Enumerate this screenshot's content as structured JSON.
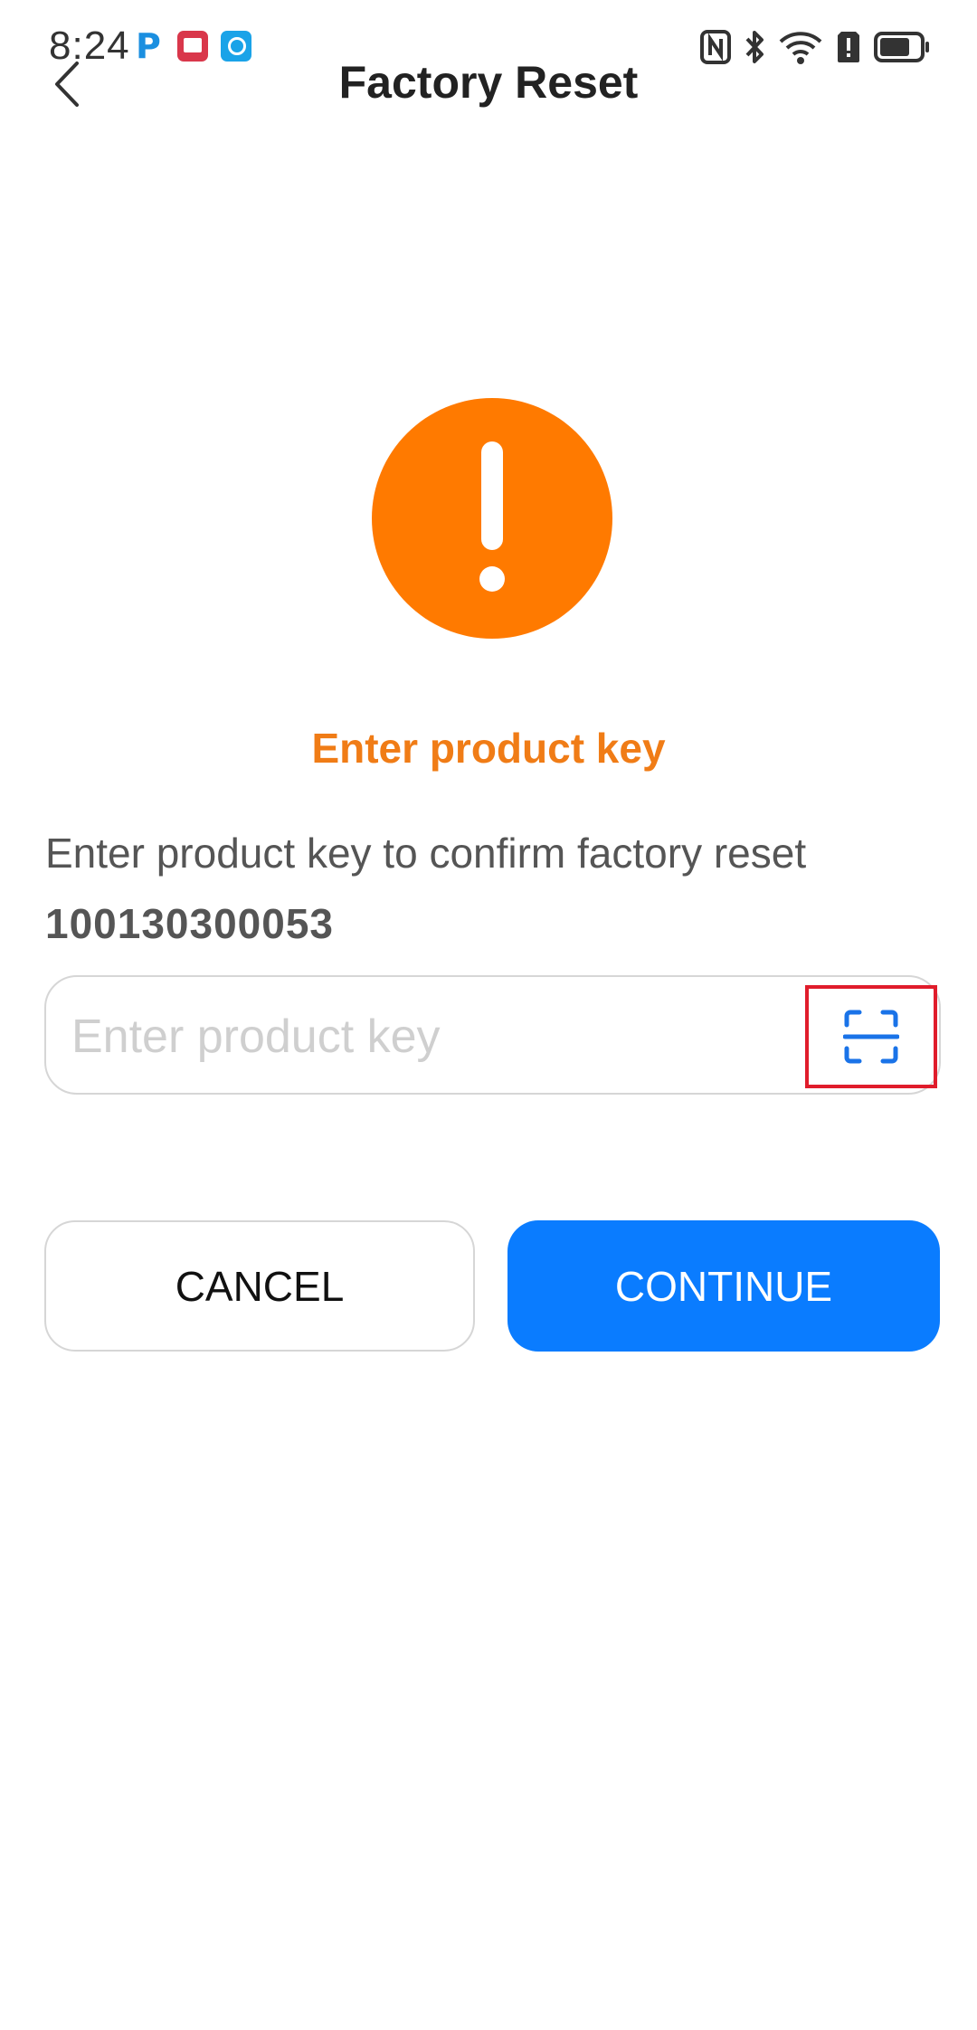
{
  "status_bar": {
    "time": "8:24",
    "app_icons": [
      "p-app-icon",
      "book-app-icon",
      "search-app-icon"
    ],
    "system_icons": [
      "nfc-icon",
      "bluetooth-icon",
      "wifi-icon",
      "alert-icon",
      "battery-icon"
    ],
    "battery_level": 0.75
  },
  "header": {
    "title": "Factory Reset",
    "back_icon": "chevron-left-icon"
  },
  "warning": {
    "icon": "exclamation-icon",
    "color": "#FF7A00"
  },
  "content": {
    "subtitle": "Enter product key",
    "instruction": "Enter product key to confirm factory reset",
    "product_key": "100130300053"
  },
  "input": {
    "value": "",
    "placeholder": "Enter product key",
    "scan_icon": "scan-icon"
  },
  "actions": {
    "cancel_label": "CANCEL",
    "continue_label": "CONTINUE"
  },
  "colors": {
    "accent": "#0A7CFF",
    "warning": "#FF7A00",
    "subtitle": "#F07C16",
    "highlight_box": "#E01C2B"
  }
}
